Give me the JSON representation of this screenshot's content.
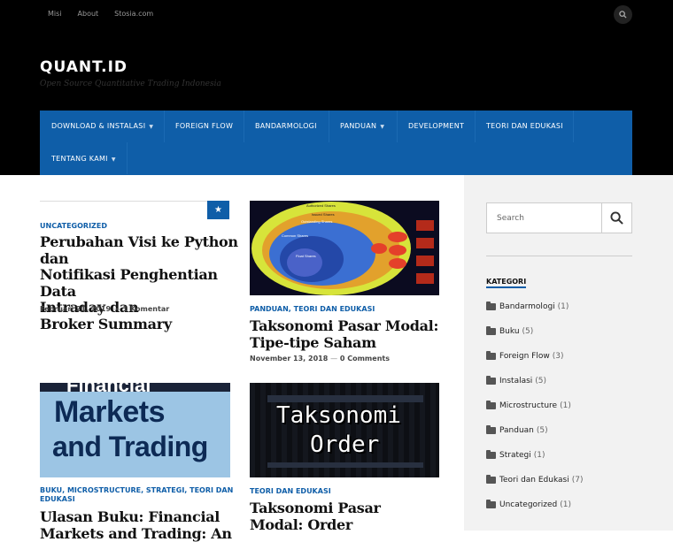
{
  "topnav": [
    {
      "label": "Misi"
    },
    {
      "label": "About"
    },
    {
      "label": "Stosia.com"
    }
  ],
  "site": {
    "title": "QUANT.ID",
    "tagline": "Open Source Quantitative Trading Indonesia"
  },
  "mainnav": [
    {
      "label": "DOWNLOAD & INSTALASI"
    },
    {
      "label": "FOREIGN FLOW"
    },
    {
      "label": "BANDARMOLOGI"
    },
    {
      "label": "PANDUAN"
    },
    {
      "label": "DEVELOPMENT"
    },
    {
      "label": "TEORI DAN EDUKASI"
    },
    {
      "label": "TENTANG KAMI"
    }
  ],
  "posts": [
    {
      "category": "UNCATEGORIZED",
      "title_lines": [
        "Perubahan Visi ke Python dan",
        "Notifikasi Penghentian Data",
        "Intraday dan",
        "Broker Summary"
      ],
      "date": "Februari 21, 2019",
      "sep": "—",
      "comments": "1 Komentar"
    },
    {
      "category": "PANDUAN, TEORI DAN EDUKASI",
      "title_lines": [
        "Taksonomi Pasar Modal:",
        "Tipe-tipe Saham"
      ],
      "date": "November 13, 2018",
      "sep": "—",
      "comments": "0 Comments",
      "image_labels": [
        "Authorized Shares",
        "Issued Shares",
        "Outstanding Shares",
        "Common Shares",
        "Float Shares"
      ]
    },
    {
      "category_lines": [
        "BUKU, MICROSTRUCTURE, STRATEGI, TEORI DAN",
        "EDUKASI"
      ],
      "title_lines": [
        "Ulasan Buku: Financial",
        "Markets and Trading: An"
      ],
      "image_text": [
        "Financial",
        "Markets",
        "and Trading"
      ]
    },
    {
      "category": "TEORI DAN EDUKASI",
      "title_lines": [
        "Taksonomi Pasar",
        "Modal: Order"
      ],
      "image_text": [
        "Taksonomi",
        "Order"
      ]
    }
  ],
  "sidebar": {
    "search_placeholder": "Search",
    "heading": "KATEGORI",
    "categories": [
      {
        "name": "Bandarmologi",
        "count": "(1)"
      },
      {
        "name": "Buku",
        "count": "(5)"
      },
      {
        "name": "Foreign Flow",
        "count": "(3)"
      },
      {
        "name": "Instalasi",
        "count": "(5)"
      },
      {
        "name": "Microstructure",
        "count": "(1)"
      },
      {
        "name": "Panduan",
        "count": "(5)"
      },
      {
        "name": "Strategi",
        "count": "(1)"
      },
      {
        "name": "Teori dan Edukasi",
        "count": "(7)"
      },
      {
        "name": "Uncategorized",
        "count": "(1)"
      }
    ]
  },
  "colors": {
    "accent": "#0f5ea8",
    "header_bg": "#000000",
    "sidebar_bg": "#f2f2f2"
  },
  "icons": {
    "search": "search-icon",
    "sticky": "star-icon",
    "category": "folder-icon"
  }
}
